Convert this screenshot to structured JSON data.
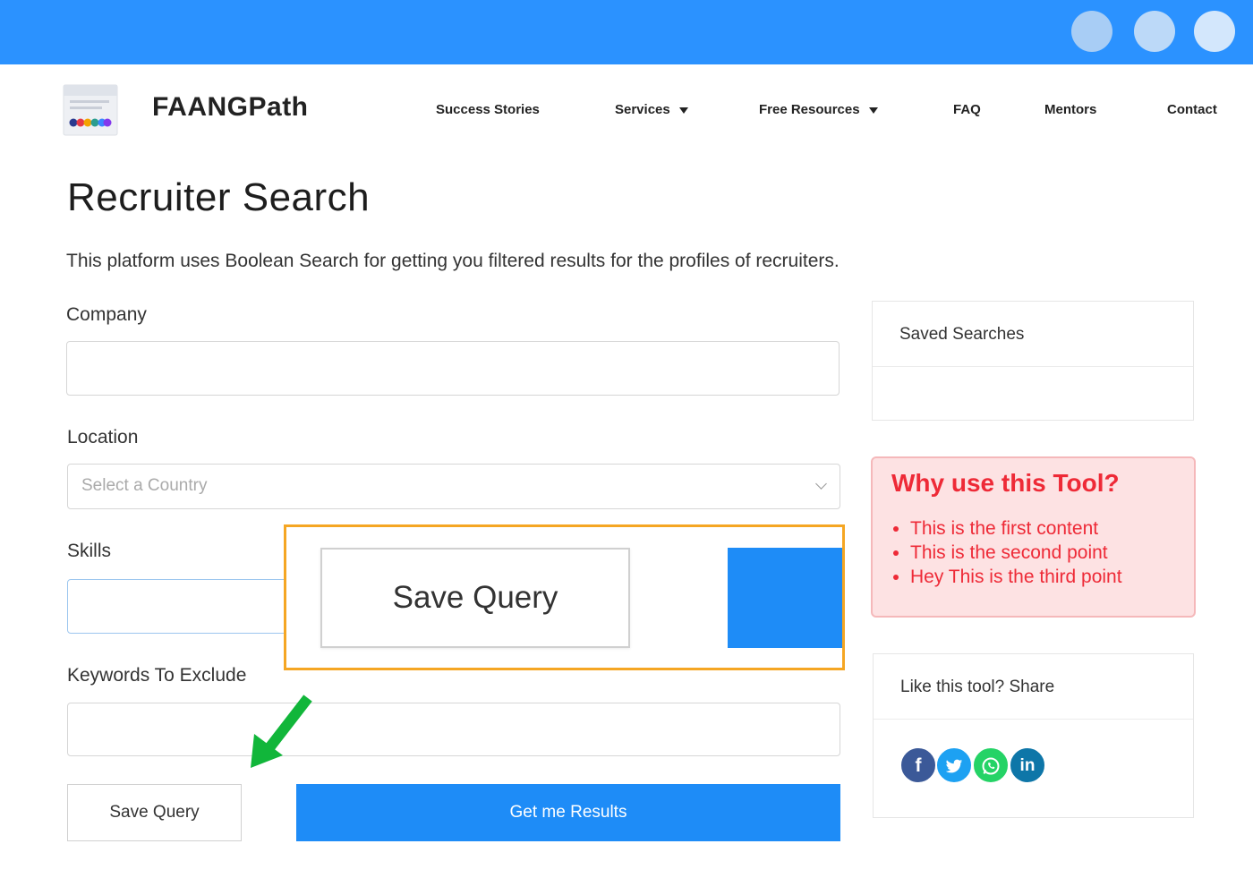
{
  "window": {
    "accent": "#2b92ff"
  },
  "header": {
    "brand": "FAANGPath",
    "nav": [
      {
        "label": "Success Stories",
        "dropdown": false
      },
      {
        "label": "Services",
        "dropdown": true
      },
      {
        "label": "Free Resources",
        "dropdown": true
      },
      {
        "label": "FAQ",
        "dropdown": false
      },
      {
        "label": "Mentors",
        "dropdown": false
      },
      {
        "label": "Contact",
        "dropdown": false
      }
    ]
  },
  "main": {
    "title": "Recruiter Search",
    "intro": "This platform uses Boolean Search for getting you filtered results for the profiles of recruiters.",
    "fields": {
      "company": {
        "label": "Company",
        "value": ""
      },
      "location": {
        "label": "Location",
        "placeholder": "Select a Country"
      },
      "skills": {
        "label": "Skills",
        "value": ""
      },
      "exclude": {
        "label": "Keywords To Exclude",
        "value": ""
      }
    },
    "buttons": {
      "save": "Save Query",
      "submit": "Get me Results"
    }
  },
  "callout": {
    "save_label": "Save Query",
    "border_color": "#f5a623",
    "arrow_color": "#11b63a"
  },
  "sidebar": {
    "saved_title": "Saved Searches",
    "why": {
      "title": "Why use this Tool?",
      "points": [
        "This is the first content",
        "This is the second point",
        "Hey This is the third point"
      ],
      "color": "#ee2a37"
    },
    "share": {
      "title": "Like this tool? Share",
      "icons": [
        "facebook-icon",
        "twitter-icon",
        "whatsapp-icon",
        "linkedin-icon"
      ]
    }
  }
}
